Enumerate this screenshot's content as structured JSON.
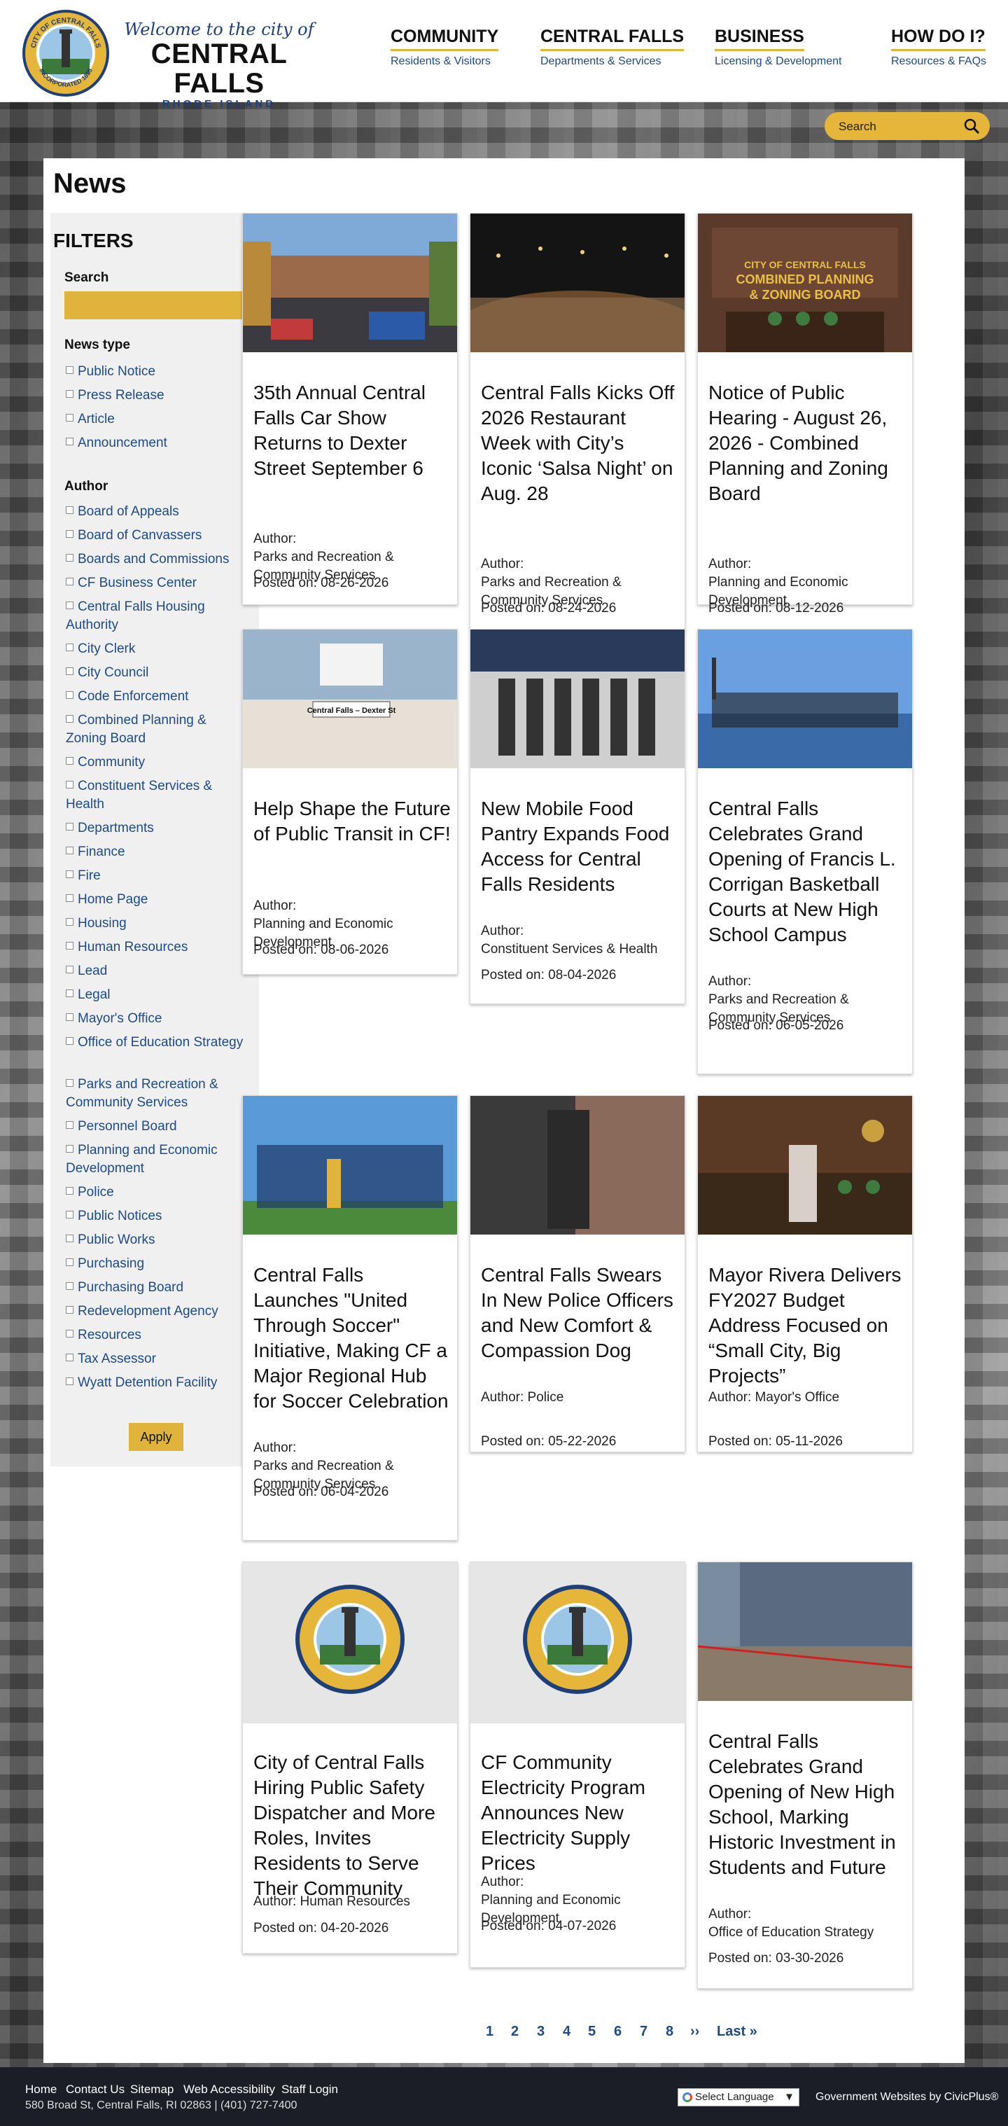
{
  "header": {
    "seal_text": "CITY OF CENTRAL FALLS",
    "seal_bottom": "INCORPORATED 1895",
    "welcome": "Welcome to the city of",
    "city": "CENTRAL FALLS",
    "state": "RHODE ISLAND",
    "nav": [
      {
        "title": "COMMUNITY",
        "sub": "Residents & Visitors"
      },
      {
        "title": "CENTRAL FALLS",
        "sub": "Departments & Services"
      },
      {
        "title": "BUSINESS",
        "sub": "Licensing & Development"
      },
      {
        "title": "HOW DO I?",
        "sub": "Resources & FAQs"
      }
    ],
    "search_placeholder": "Search"
  },
  "page_title": "News",
  "filters": {
    "heading": "FILTERS",
    "search_label": "Search",
    "news_type_label": "News type",
    "news_types": [
      "Public Notice",
      "Press Release",
      "Article",
      "Announcement"
    ],
    "author_label": "Author",
    "authors": [
      "Board of Appeals",
      "Board of Canvassers",
      "Boards and Commissions",
      "CF Business Center",
      "Central Falls Housing Authority",
      "City Clerk",
      "City Council",
      "Code Enforcement",
      "Combined Planning & Zoning Board",
      "Community",
      "Constituent Services & Health",
      "Departments",
      "Finance",
      "Fire",
      "Home Page",
      "Housing",
      "Human Resources",
      "Lead",
      "Legal",
      "Mayor's Office",
      "Office of Education Strategy",
      "Parks and Recreation & Community Services",
      "Personnel Board",
      "Planning and Economic Development",
      "Police",
      "Public Notices",
      "Public Works",
      "Purchasing",
      "Purchasing Board",
      "Redevelopment Agency",
      "Resources",
      "Tax Assessor",
      "Wyatt Detention Facility"
    ],
    "apply_label": "Apply"
  },
  "articles": [
    {
      "title": "35th Annual Central Falls Car Show Returns to Dexter Street September 6",
      "author_label": "Author:",
      "author": "Parks and Recreation & Community Services",
      "posted": "Posted on: 08-26-2026"
    },
    {
      "title": "Central Falls Kicks Off 2026 Restaurant Week with City’s Iconic ‘Salsa Night’ on Aug. 28",
      "author_label": "Author:",
      "author": "Parks and Recreation & Community Services",
      "posted": "Posted on: 08-24-2026"
    },
    {
      "title": "Notice of Public Hearing - August 26, 2026 - Combined Planning and Zoning Board",
      "author_label": "Author:",
      "author": "Planning and Economic Development",
      "posted": "Posted on: 08-12-2026",
      "img_text": "CITY OF CENTRAL FALLS\nCOMBINED PLANNING\n& ZONING BOARD"
    },
    {
      "title": "Help Shape the Future of Public Transit in CF!",
      "author_label": "Author:",
      "author": "Planning and Economic Development",
      "posted": "Posted on: 08-06-2026",
      "img_text": "Central Falls – Dexter St"
    },
    {
      "title": "New Mobile Food Pantry Expands Food Access for Central Falls Residents",
      "author_label": "Author:",
      "author": "Constituent Services & Health",
      "posted": "Posted on: 08-04-2026"
    },
    {
      "title": "Central Falls Celebrates Grand Opening of Francis L. Corrigan Basketball Courts at New High School Campus",
      "author_label": "Author:",
      "author": "Parks and Recreation & Community Services",
      "posted": "Posted on: 06-05-2026"
    },
    {
      "title": "Central Falls Launches \"United Through Soccer\" Initiative, Making CF a Major Regional Hub for Soccer Celebration",
      "author_label": "Author:",
      "author": "Parks and Recreation & Community Services",
      "posted": "Posted on: 06-04-2026"
    },
    {
      "title": "Central Falls Swears In New Police Officers and New Comfort & Compassion Dog",
      "author_label": "Author:",
      "author": "Police",
      "posted": "Posted on: 05-22-2026"
    },
    {
      "title": "Mayor Rivera Delivers FY2027 Budget Address Focused on “Small City, Big Projects”",
      "author_label": "Author:",
      "author": "Mayor's Office",
      "posted": "Posted on: 05-11-2026"
    },
    {
      "title": "City of Central Falls Hiring Public Safety Dispatcher and More Roles, Invites Residents to Serve Their Community",
      "author_label": "Author:",
      "author": "Human Resources",
      "posted": "Posted on: 04-20-2026"
    },
    {
      "title": "CF Community Electricity Program Announces New Electricity Supply Prices",
      "author_label": "Author:",
      "author": "Planning and Economic Development",
      "posted": "Posted on: 04-07-2026"
    },
    {
      "title": "Central Falls Celebrates Grand Opening of New High School, Marking Historic Investment in Students and Future",
      "author_label": "Author:",
      "author": "Office of Education Strategy",
      "posted": "Posted on: 03-30-2026"
    }
  ],
  "pagination": [
    "1",
    "2",
    "3",
    "4",
    "5",
    "6",
    "7",
    "8",
    "››",
    "Last »"
  ],
  "footer": {
    "links": [
      "Home",
      "Contact Us",
      "Sitemap",
      "Web Accessibility",
      "Staff Login"
    ],
    "address": "580 Broad St, Central Falls, RI 02863 | (401) 727-7400",
    "language": "Select Language",
    "credit": "Government Websites by CivicPlus®"
  },
  "colors": {
    "accent": "#e0b43a",
    "link": "#1d4a8a",
    "footer": "#1b1e26"
  }
}
